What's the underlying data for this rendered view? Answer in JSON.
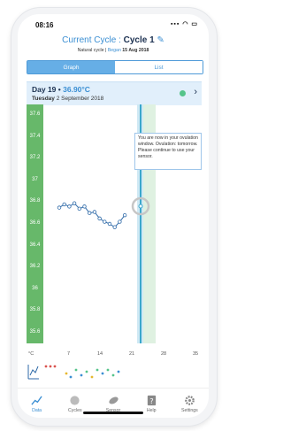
{
  "status": {
    "time": "08:16",
    "icons": "▪▪▪ ◠ ▭"
  },
  "header": {
    "title_prefix": "Current Cycle :",
    "cycle_name": "Cycle 1",
    "cycle_type": "Natural cycle",
    "began_label": "Began",
    "began_date": "15 Aug 2018"
  },
  "tabs": [
    "Graph",
    "List"
  ],
  "day": {
    "label": "Day 19 •",
    "temp": "36.90°C",
    "weekday": "Tuesday",
    "date": "2 September 2018"
  },
  "tooltip": {
    "text": "You are now in your ovulation window. Ovulation: tomorrow. Please continue to use your sensor."
  },
  "chart_data": {
    "type": "line",
    "y_ticks": [
      "37.6",
      "37.4",
      "37.2",
      "37",
      "36.8",
      "36.6",
      "36.4",
      "36.2",
      "36",
      "35.8",
      "35.6"
    ],
    "x_ticks": [
      "7",
      "14",
      "21",
      "28",
      "35"
    ],
    "x_label_prefix": "°C",
    "ylim": [
      35.5,
      37.7
    ],
    "series": [
      {
        "values": [
          36.75,
          36.78,
          36.76,
          36.79,
          36.74,
          36.76,
          36.7,
          36.71,
          36.65,
          36.62,
          36.6,
          36.57,
          36.62,
          36.68
        ]
      }
    ],
    "colors": {
      "axis": "#67b86a",
      "line": "#3b8fd3",
      "window": "#d8efdb",
      "today": "#3aa7cc"
    }
  },
  "nav": [
    {
      "label": "Data",
      "icon": "chart-icon"
    },
    {
      "label": "Cycles",
      "icon": "circle-icon"
    },
    {
      "label": "Sensor",
      "icon": "leaf-icon"
    },
    {
      "label": "Help",
      "icon": "question-icon"
    },
    {
      "label": "Settings",
      "icon": "gear-icon"
    }
  ]
}
